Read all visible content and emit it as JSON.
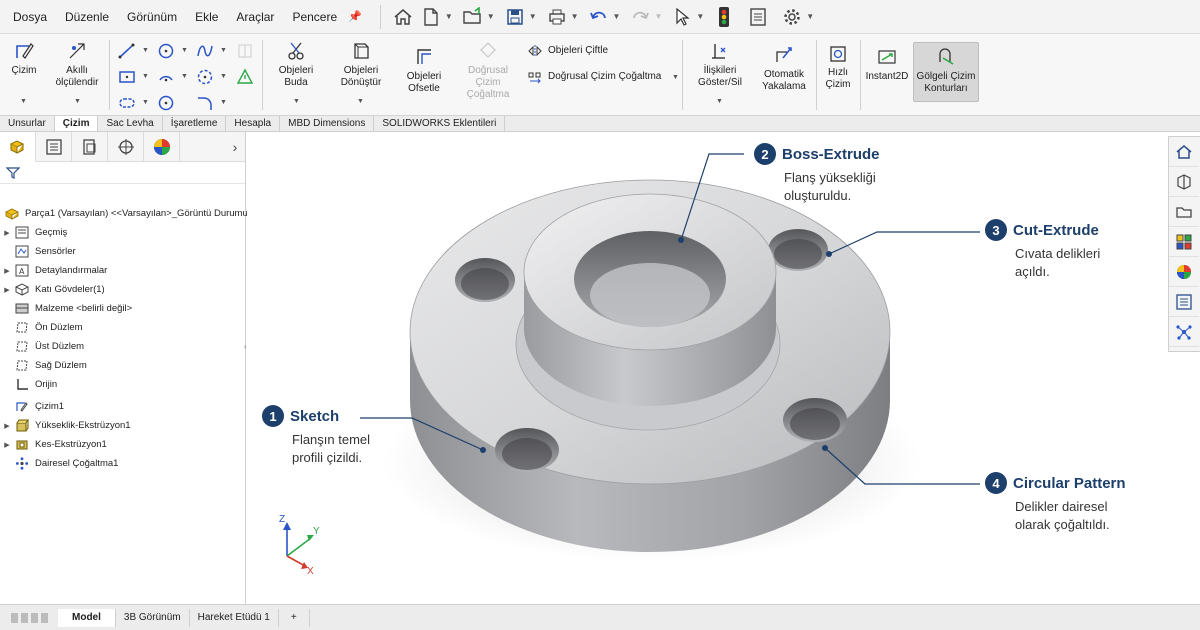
{
  "menu": {
    "items": [
      "Dosya",
      "Düzenle",
      "Görünüm",
      "Ekle",
      "Araçlar",
      "Pencere"
    ]
  },
  "ribbon": {
    "sketch": "Çizim",
    "smart_dim_1": "Akıllı",
    "smart_dim_2": "ölçülendir",
    "trim_1": "Objeleri",
    "trim_2": "Buda",
    "convert_1": "Objeleri",
    "convert_2": "Dönüştür",
    "offset_1": "Objeleri",
    "offset_2": "Ofsetle",
    "linear_pattern_1": "Doğrusal",
    "linear_pattern_2": "Çizim",
    "linear_pattern_3": "Çoğaltma",
    "mirror": "Objeleri Çiftle",
    "linear_sketch_pattern": "Doğrusal Çizim Çoğaltma",
    "relations_1": "İlişkileri",
    "relations_2": "Göster/Sil",
    "quick_snap_1": "Otomatik",
    "quick_snap_2": "Yakalama",
    "rapid_sketch_1": "Hızlı",
    "rapid_sketch_2": "Çizim",
    "instant2d": "Instant2D",
    "shaded_1": "Gölgeli Çizim",
    "shaded_2": "Konturları"
  },
  "command_tabs": [
    "Unsurlar",
    "Çizim",
    "Sac Levha",
    "İşaretleme",
    "Hesapla",
    "MBD Dimensions",
    "SOLIDWORKS Eklentileri"
  ],
  "tree": {
    "root": "Parça1  (Varsayılan) <<Varsayılan>_Görüntü Durumu",
    "items": [
      {
        "label": "Geçmiş",
        "expand": true
      },
      {
        "label": "Sensörler",
        "expand": false
      },
      {
        "label": "Detaylandırmalar",
        "expand": true
      },
      {
        "label": "Katı Gövdeler(1)",
        "expand": true
      },
      {
        "label": "Malzeme <belirli değil>",
        "expand": false
      },
      {
        "label": "Ön Düzlem",
        "expand": false
      },
      {
        "label": "Üst Düzlem",
        "expand": false
      },
      {
        "label": "Sağ Düzlem",
        "expand": false
      },
      {
        "label": "Orijin",
        "expand": false
      },
      {
        "label": "Çizim1",
        "expand": false
      },
      {
        "label": "Yükseklik-Ekstrüzyon1",
        "expand": true
      },
      {
        "label": "Kes-Ekstrüzyon1",
        "expand": true
      },
      {
        "label": "Dairesel Çoğaltma1",
        "expand": false
      }
    ]
  },
  "callouts": [
    {
      "num": "1",
      "title": "Sketch",
      "desc1": "Flanşın temel",
      "desc2": "profili çizildi."
    },
    {
      "num": "2",
      "title": "Boss-Extrude",
      "desc1": "Flanş yüksekliği",
      "desc2": "oluşturuldu."
    },
    {
      "num": "3",
      "title": "Cut-Extrude",
      "desc1": "Cıvata delikleri",
      "desc2": "açıldı."
    },
    {
      "num": "4",
      "title": "Circular Pattern",
      "desc1": "Delikler dairesel",
      "desc2": "olarak çoğaltıldı."
    }
  ],
  "triad": {
    "x": "X",
    "y": "Y",
    "z": "Z"
  },
  "bottom_tabs": [
    "Model",
    "3B Görünüm",
    "Hareket Etüdü 1"
  ],
  "bottom_add": "+",
  "colors": {
    "accent": "#1d3f6b",
    "triad_x": "#d23a2a",
    "triad_y": "#2aa845",
    "triad_z": "#2a55c9"
  }
}
